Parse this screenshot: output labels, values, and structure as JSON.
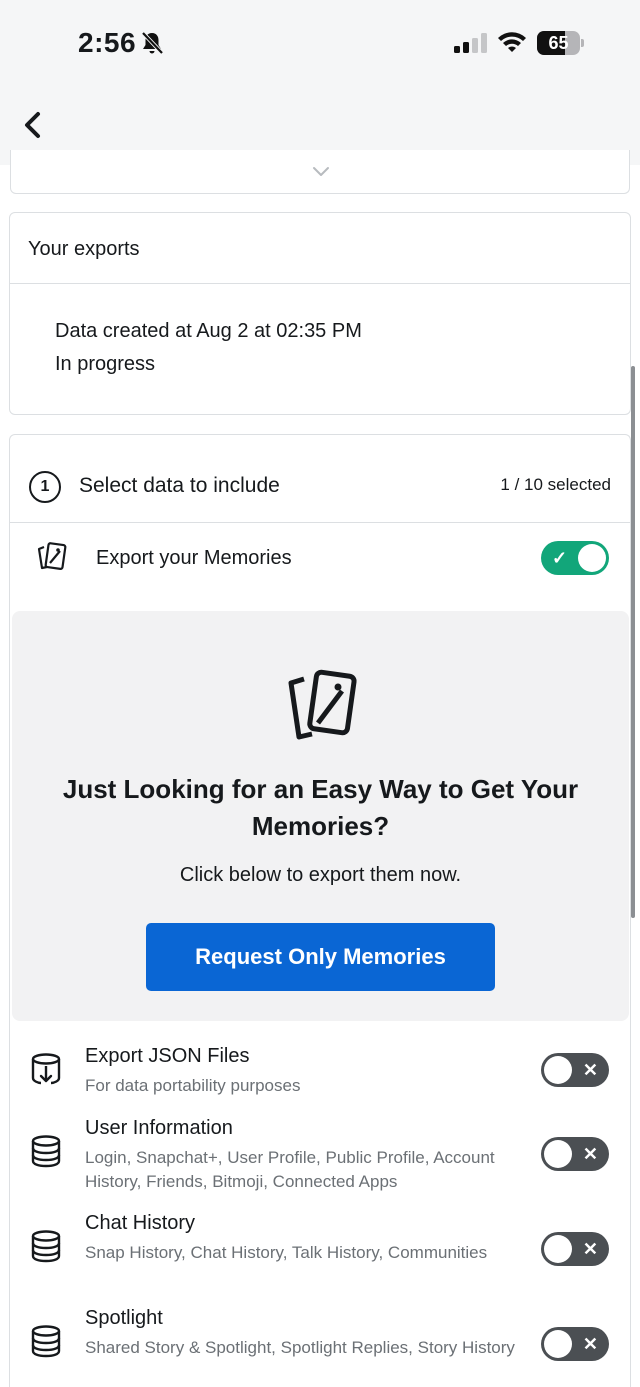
{
  "status_bar": {
    "time": "2:56",
    "battery_text": "65",
    "battery_level": 0.65
  },
  "exports": {
    "title": "Your exports",
    "line1": "Data created at Aug 2 at 02:35 PM",
    "line2": "In progress"
  },
  "select": {
    "step_number": "1",
    "title": "Select data to include",
    "count": "1 / 10 selected",
    "memories_label": "Export your Memories",
    "memories_enabled": true
  },
  "promo": {
    "title": "Just Looking for an Easy Way to Get Your Memories?",
    "subtitle": "Click below to export them now.",
    "button_label": "Request Only Memories"
  },
  "data_items": [
    {
      "title": "Export JSON Files",
      "description": "For data portability purposes",
      "enabled": false,
      "icon": "export-download-icon"
    },
    {
      "title": "User Information",
      "description": "Login, Snapchat+, User Profile, Public Profile, Account History, Friends, Bitmoji, Connected Apps",
      "enabled": false,
      "icon": "database-icon"
    },
    {
      "title": "Chat History",
      "description": "Snap History, Chat History, Talk History, Communities",
      "enabled": false,
      "icon": "database-icon"
    },
    {
      "title": "Spotlight",
      "description": "Shared Story & Spotlight, Spotlight Replies, Story History",
      "enabled": false,
      "icon": "database-icon"
    }
  ],
  "colors": {
    "toggle_on": "#12a67a",
    "toggle_off": "#4b4f53",
    "primary_button": "#0a66d4"
  }
}
